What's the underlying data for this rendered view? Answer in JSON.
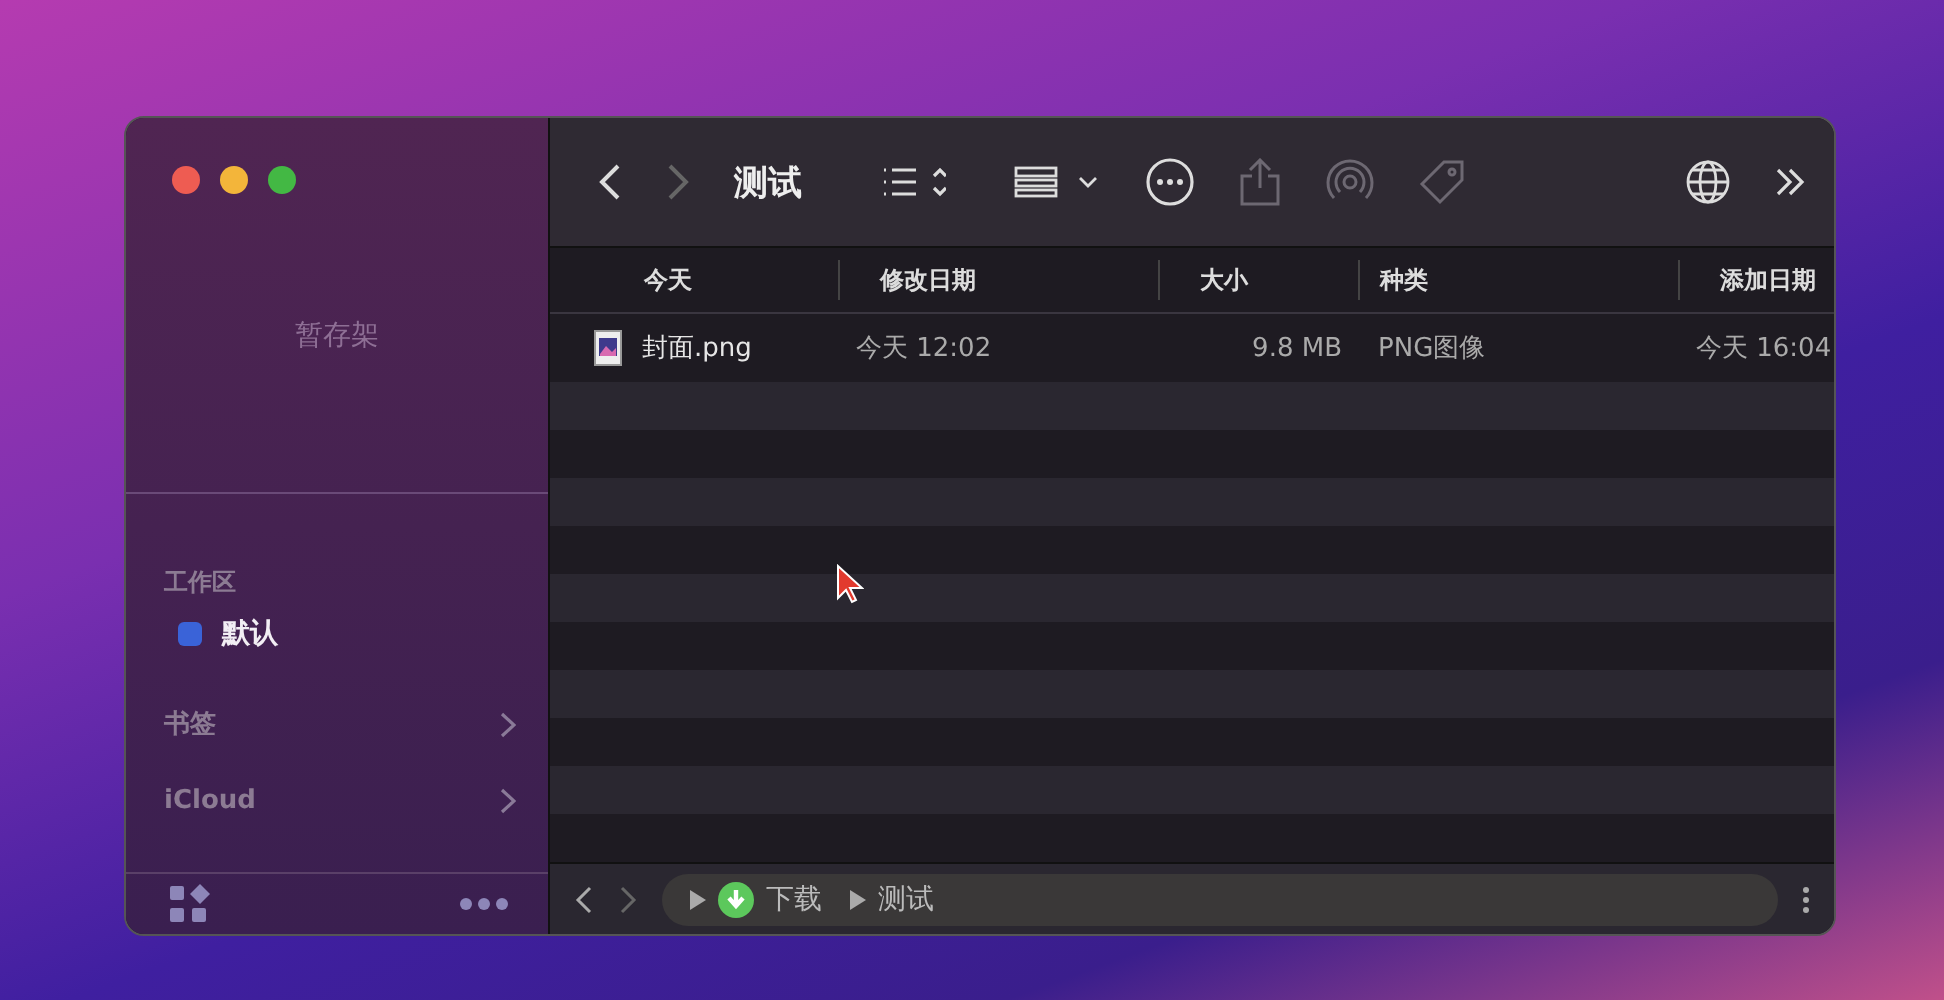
{
  "sidebar": {
    "shelf_label": "暂存架",
    "sections": [
      {
        "kind": "header",
        "label": "工作区"
      },
      {
        "kind": "workspace",
        "label": "默认",
        "color": "#3a63d8",
        "selected": true
      },
      {
        "kind": "group",
        "label": "书签"
      },
      {
        "kind": "group",
        "label": "iCloud"
      }
    ]
  },
  "toolbar": {
    "title": "测试",
    "back_disabled": false,
    "forward_disabled": true
  },
  "table": {
    "columns": [
      "今天",
      "修改日期",
      "大小",
      "种类",
      "添加日期"
    ],
    "rows": [
      {
        "name": "封面.png",
        "modified": "今天 12:02",
        "size": "9.8 MB",
        "kind": "PNG图像",
        "added": "今天 16:04"
      }
    ]
  },
  "path_bar": {
    "items": [
      "下载",
      "测试"
    ]
  }
}
